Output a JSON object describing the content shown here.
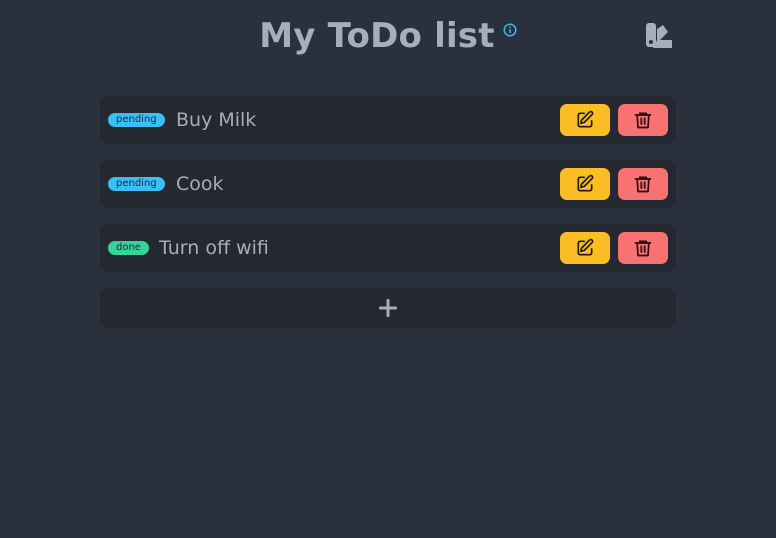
{
  "header": {
    "title": "My ToDo list",
    "info_icon": "info-circle-icon",
    "theme_icon": "theme-swatch-icon"
  },
  "todos": [
    {
      "status": "pending",
      "text": "Buy Milk"
    },
    {
      "status": "pending",
      "text": "Cook"
    },
    {
      "status": "done",
      "text": "Turn off wifi"
    }
  ],
  "actions": {
    "edit_icon": "pencil-square-icon",
    "delete_icon": "trash-icon",
    "add_icon": "plus-icon"
  },
  "colors": {
    "background": "#2a303c",
    "card": "#232831",
    "text": "#a6adbb",
    "pending": "#3abff8",
    "done": "#36d399",
    "edit": "#fbbd23",
    "delete": "#f87272",
    "info": "#3abff8"
  }
}
